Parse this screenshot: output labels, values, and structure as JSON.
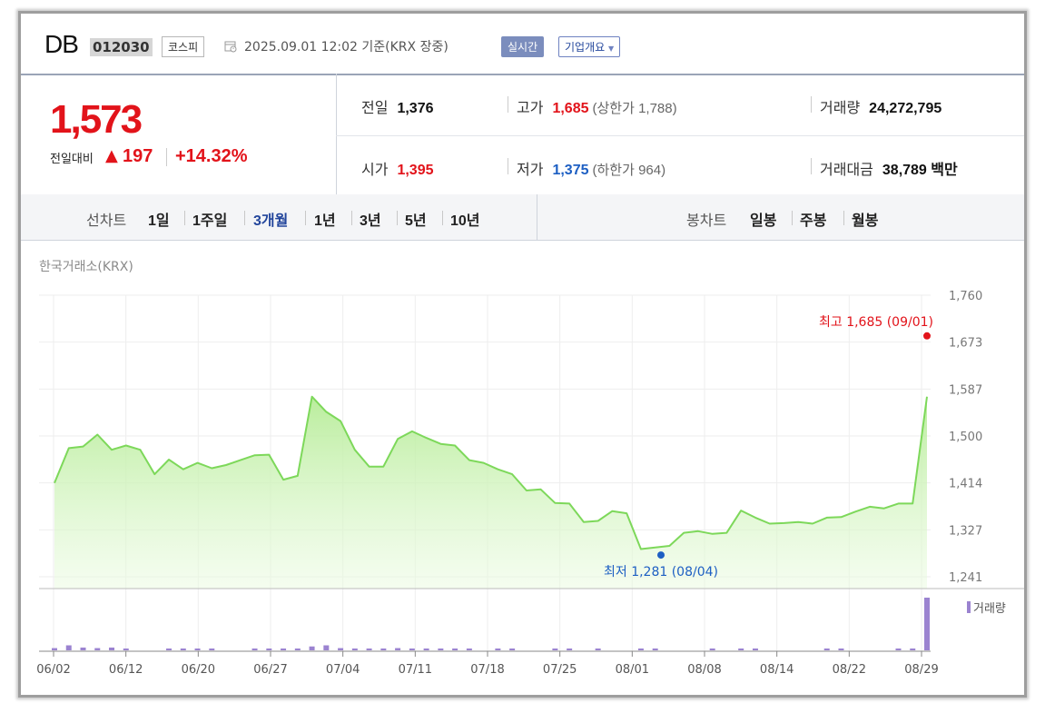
{
  "header": {
    "name": "DB",
    "code": "012030",
    "market": "코스피",
    "datetime": "2025.09.01 12:02 기준(KRX 장중)",
    "realtime_btn": "실시간",
    "company_btn": "기업개요"
  },
  "quote": {
    "price": "1,573",
    "diff_label": "전일대비",
    "diff_arrow": "▲",
    "diff_value": "197",
    "diff_pct": "+14.32%",
    "prev_label": "전일",
    "prev": "1,376",
    "high_label": "고가",
    "high": "1,685",
    "upper_limit": "(상한가 1,788)",
    "volume_label": "거래량",
    "volume": "24,272,795",
    "open_label": "시가",
    "open": "1,395",
    "low_label": "저가",
    "low": "1,375",
    "lower_limit": "(하한가 964)",
    "amount_label": "거래대금",
    "amount": "38,789 백만"
  },
  "periods": {
    "line_label": "선차트",
    "items": [
      "1일",
      "1주일",
      "3개월",
      "1년",
      "3년",
      "5년",
      "10년"
    ],
    "active": "3개월",
    "candle_label": "봉차트",
    "candle_items": [
      "일봉",
      "주봉",
      "월봉"
    ]
  },
  "exchange": "한국거래소(KRX)",
  "colors": {
    "up": "#e2131a",
    "down": "#1d5fc3",
    "line": "#7dd85a",
    "volume": "#9b83d0"
  },
  "chart_data": {
    "type": "area",
    "y_ticks": [
      "1,760",
      "1,673",
      "1,587",
      "1,500",
      "1,414",
      "1,327",
      "1,241"
    ],
    "ylim": [
      1241,
      1760
    ],
    "x_labels": [
      "06/02",
      "06/12",
      "06/20",
      "06/27",
      "07/04",
      "07/11",
      "07/18",
      "07/25",
      "08/01",
      "08/08",
      "08/14",
      "08/22",
      "08/29"
    ],
    "values": [
      1414,
      1478,
      1481,
      1503,
      1475,
      1483,
      1475,
      1430,
      1457,
      1439,
      1451,
      1441,
      1447,
      1456,
      1465,
      1466,
      1420,
      1427,
      1573,
      1545,
      1528,
      1475,
      1444,
      1444,
      1495,
      1509,
      1497,
      1486,
      1483,
      1456,
      1451,
      1439,
      1430,
      1400,
      1402,
      1377,
      1376,
      1342,
      1344,
      1362,
      1358,
      1292,
      1295,
      1298,
      1322,
      1325,
      1320,
      1322,
      1363,
      1350,
      1339,
      1340,
      1342,
      1339,
      1350,
      1351,
      1361,
      1370,
      1367,
      1376,
      1376,
      1573
    ],
    "volume_legend": "거래량",
    "volumes": [
      4,
      9,
      5,
      4,
      5,
      3,
      0,
      0,
      3,
      3,
      3,
      3,
      0,
      0,
      3,
      3,
      2,
      2,
      7,
      9,
      4,
      3,
      3,
      3,
      4,
      3,
      3,
      3,
      3,
      3,
      0,
      3,
      3,
      0,
      0,
      3,
      3,
      0,
      3,
      0,
      0,
      3,
      2,
      0,
      0,
      0,
      2,
      0,
      3,
      3,
      0,
      0,
      0,
      0,
      3,
      3,
      0,
      0,
      0,
      2,
      3,
      95
    ],
    "high_annotation": "최고 1,685 (09/01)",
    "high_value": 1685,
    "low_annotation": "최저 1,281 (08/04)",
    "low_value": 1281
  }
}
